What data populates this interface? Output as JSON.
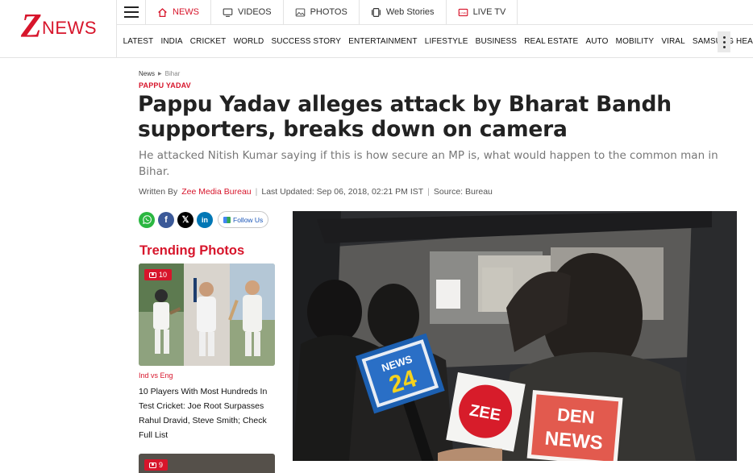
{
  "brand": {
    "logo_letter": "Z",
    "logo_word": "NEWS",
    "color": "#d7152b"
  },
  "topnav": [
    {
      "label": "NEWS",
      "icon": "home-icon",
      "active": true
    },
    {
      "label": "VIDEOS",
      "icon": "monitor-icon"
    },
    {
      "label": "PHOTOS",
      "icon": "photo-icon"
    },
    {
      "label": "Web Stories",
      "icon": "web-stories-icon"
    },
    {
      "label": "LIVE TV",
      "icon": "live-tv-icon"
    }
  ],
  "categories": [
    "LATEST",
    "INDIA",
    "CRICKET",
    "WORLD",
    "SUCCESS STORY",
    "ENTERTAINMENT",
    "LIFESTYLE",
    "BUSINESS",
    "REAL ESTATE",
    "AUTO",
    "MOBILITY",
    "VIRAL",
    "SAMSUNG HEALTH"
  ],
  "breadcrumb": {
    "home": "News",
    "current": "Bihar"
  },
  "article": {
    "kicker": "PAPPU YADAV",
    "headline": "Pappu Yadav alleges attack by Bharat Bandh supporters, breaks down on camera",
    "subhead": "He attacked Nitish Kumar saying if this is how secure an MP is, what would happen to the common man in Bihar.",
    "byline": {
      "written_by": "Written By",
      "author": "Zee Media Bureau",
      "updated": "Last Updated: Sep 06, 2018, 02:21 PM IST",
      "source": "Source: Bureau"
    }
  },
  "share": {
    "follow_label": "Follow Us"
  },
  "trending": {
    "title": "Trending Photos",
    "cards": [
      {
        "count": "10",
        "category": "Ind vs Eng",
        "title": "10 Players With Most Hundreds In Test Cricket: Joe Root Surpasses Rahul Dravid, Steve Smith; Check Full List"
      },
      {
        "count": "9"
      }
    ]
  },
  "hero": {
    "mic_labels": {
      "news24_top": "NEWS",
      "news24_num": "24",
      "zee": "ZEE",
      "den_top": "DEN",
      "den_bottom": "NEWS"
    }
  }
}
